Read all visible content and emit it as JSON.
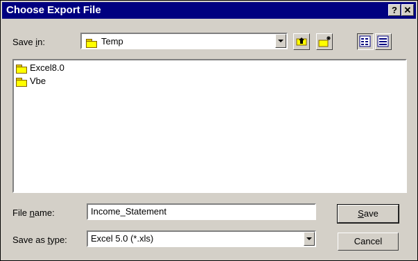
{
  "window": {
    "title": "Choose Export File",
    "help_label": "?",
    "close_label": "✕"
  },
  "save_in": {
    "label_pre": "Save ",
    "label_u": "i",
    "label_post": "n:",
    "value": "Temp"
  },
  "toolbar": {
    "up_icon": "up-folder-icon",
    "new_folder_icon": "new-folder-icon",
    "list_icon": "list-view-icon",
    "details_icon": "details-view-icon"
  },
  "files": [
    {
      "name": "Excel8.0",
      "icon": "folder-icon"
    },
    {
      "name": "Vbe",
      "icon": "folder-icon"
    }
  ],
  "file_name": {
    "label_pre": "File ",
    "label_u": "n",
    "label_post": "ame:",
    "value": "Income_Statement"
  },
  "save_as_type": {
    "label_pre": "Save as ",
    "label_u": "t",
    "label_post": "ype:",
    "value": "Excel 5.0 (*.xls)"
  },
  "buttons": {
    "save_u": "S",
    "save_post": "ave",
    "cancel": "Cancel"
  },
  "colors": {
    "titlebar": "#000080",
    "face": "#d4d0c8"
  }
}
